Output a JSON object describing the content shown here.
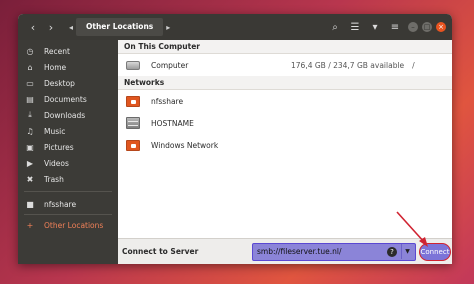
{
  "titlebar": {
    "location": "Other Locations"
  },
  "sidebar": {
    "items": [
      {
        "label": "Recent",
        "icon": "clock-icon"
      },
      {
        "label": "Home",
        "icon": "home-icon"
      },
      {
        "label": "Desktop",
        "icon": "desktop-icon"
      },
      {
        "label": "Documents",
        "icon": "documents-icon"
      },
      {
        "label": "Downloads",
        "icon": "download-icon"
      },
      {
        "label": "Music",
        "icon": "music-icon"
      },
      {
        "label": "Pictures",
        "icon": "pictures-icon"
      },
      {
        "label": "Videos",
        "icon": "videos-icon"
      },
      {
        "label": "Trash",
        "icon": "trash-icon"
      }
    ],
    "mounts": [
      {
        "label": "nfsshare",
        "icon": "folder-icon"
      }
    ],
    "other": {
      "label": "Other Locations",
      "icon": "plus-icon"
    }
  },
  "main": {
    "on_this_computer": "On This Computer",
    "computer": {
      "name": "Computer",
      "size": "176,4 GB / 234,7 GB available",
      "path": "/"
    },
    "networks_heading": "Networks",
    "networks": [
      {
        "name": "nfsshare",
        "icon": "folder-icon"
      },
      {
        "name": "HOSTNAME",
        "icon": "server-icon"
      },
      {
        "name": "Windows Network",
        "icon": "folder-icon"
      }
    ]
  },
  "connect_bar": {
    "label": "Connect to Server",
    "server_value": "smb://fileserver.tue.nl/",
    "connect_label": "Connect"
  },
  "colors": {
    "accent": "#e95420",
    "highlight": "#8b84d8",
    "annotation_red": "#d02331"
  }
}
